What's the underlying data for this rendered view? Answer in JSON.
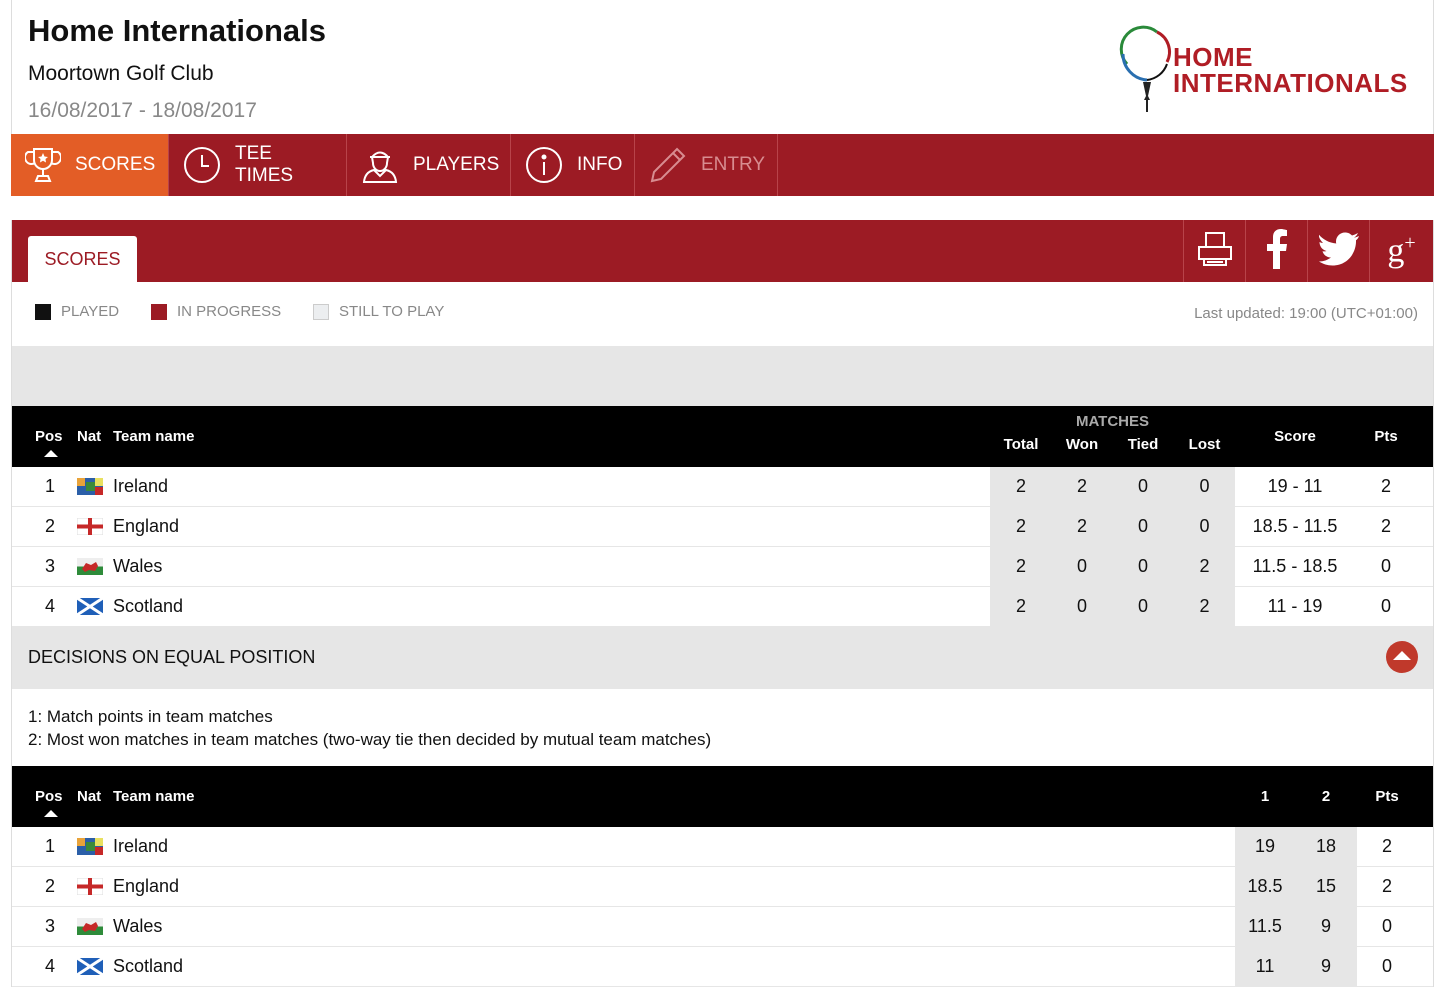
{
  "header": {
    "title": "Home Internationals",
    "venue": "Moortown Golf Club",
    "dates": "16/08/2017 - 18/08/2017",
    "logo_line1": "HOME",
    "logo_line2": "INTERNATIONALS"
  },
  "nav": [
    {
      "label": "SCORES",
      "icon": "trophy-icon",
      "active": true
    },
    {
      "label": "TEE TIMES",
      "icon": "clock-icon"
    },
    {
      "label": "PLAYERS",
      "icon": "player-icon"
    },
    {
      "label": "INFO",
      "icon": "info-icon"
    },
    {
      "label": "ENTRY",
      "icon": "pencil-icon",
      "disabled": true
    }
  ],
  "panel": {
    "tab_label": "SCORES",
    "share_icons": [
      "print-icon",
      "facebook-icon",
      "twitter-icon",
      "google-plus-icon"
    ]
  },
  "legend": {
    "played": "PLAYED",
    "in_progress": "IN PROGRESS",
    "still_to_play": "STILL TO PLAY",
    "last_updated": "Last updated: 19:00 (UTC+01:00)",
    "colors": {
      "played": "#111111",
      "in_progress": "#9c1b24",
      "still_to_play": "#eceef0"
    }
  },
  "standings": {
    "headers": {
      "pos": "Pos",
      "nat": "Nat",
      "team": "Team name",
      "matches": "MATCHES",
      "total": "Total",
      "won": "Won",
      "tied": "Tied",
      "lost": "Lost",
      "score": "Score",
      "pts": "Pts"
    },
    "rows": [
      {
        "pos": "1",
        "flag": "ireland",
        "team": "Ireland",
        "total": "2",
        "won": "2",
        "tied": "0",
        "lost": "0",
        "score": "19 - 11",
        "pts": "2"
      },
      {
        "pos": "2",
        "flag": "england",
        "team": "England",
        "total": "2",
        "won": "2",
        "tied": "0",
        "lost": "0",
        "score": "18.5 - 11.5",
        "pts": "2"
      },
      {
        "pos": "3",
        "flag": "wales",
        "team": "Wales",
        "total": "2",
        "won": "0",
        "tied": "0",
        "lost": "2",
        "score": "11.5 - 18.5",
        "pts": "0"
      },
      {
        "pos": "4",
        "flag": "scotland",
        "team": "Scotland",
        "total": "2",
        "won": "0",
        "tied": "0",
        "lost": "2",
        "score": "11 - 19",
        "pts": "0"
      }
    ]
  },
  "decisions": {
    "title": "DECISIONS ON EQUAL POSITION",
    "rule1": "1:  Match points in team matches",
    "rule2": "2:  Most won matches in team matches (two-way tie then decided by mutual team matches)"
  },
  "tiebreak": {
    "headers": {
      "pos": "Pos",
      "nat": "Nat",
      "team": "Team name",
      "c1": "1",
      "c2": "2",
      "pts": "Pts"
    },
    "rows": [
      {
        "pos": "1",
        "flag": "ireland",
        "team": "Ireland",
        "c1": "19",
        "c2": "18",
        "pts": "2"
      },
      {
        "pos": "2",
        "flag": "england",
        "team": "England",
        "c1": "18.5",
        "c2": "15",
        "pts": "2"
      },
      {
        "pos": "3",
        "flag": "wales",
        "team": "Wales",
        "c1": "11.5",
        "c2": "9",
        "pts": "0"
      },
      {
        "pos": "4",
        "flag": "scotland",
        "team": "Scotland",
        "c1": "11",
        "c2": "9",
        "pts": "0"
      }
    ]
  },
  "colors": {
    "brand": "#9c1b24",
    "active_tab": "#e35d26"
  }
}
